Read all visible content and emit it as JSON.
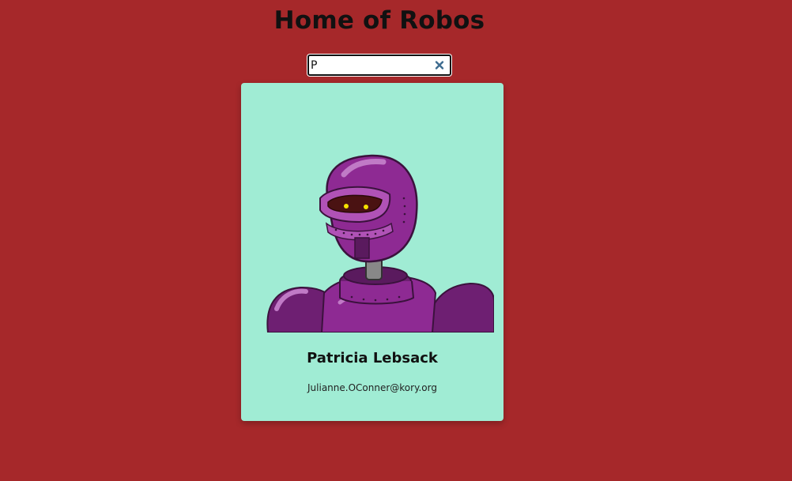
{
  "header": {
    "title": "Home of Robos"
  },
  "search": {
    "value": "P",
    "clear_icon": "close-icon"
  },
  "cards": [
    {
      "name": "Patricia Lebsack",
      "email": "Julianne.OConner@kory.org",
      "image_icon": "robot-avatar"
    }
  ],
  "colors": {
    "background": "#a6282a",
    "card": "#a0ecd4",
    "robot": "#8e2a93"
  }
}
